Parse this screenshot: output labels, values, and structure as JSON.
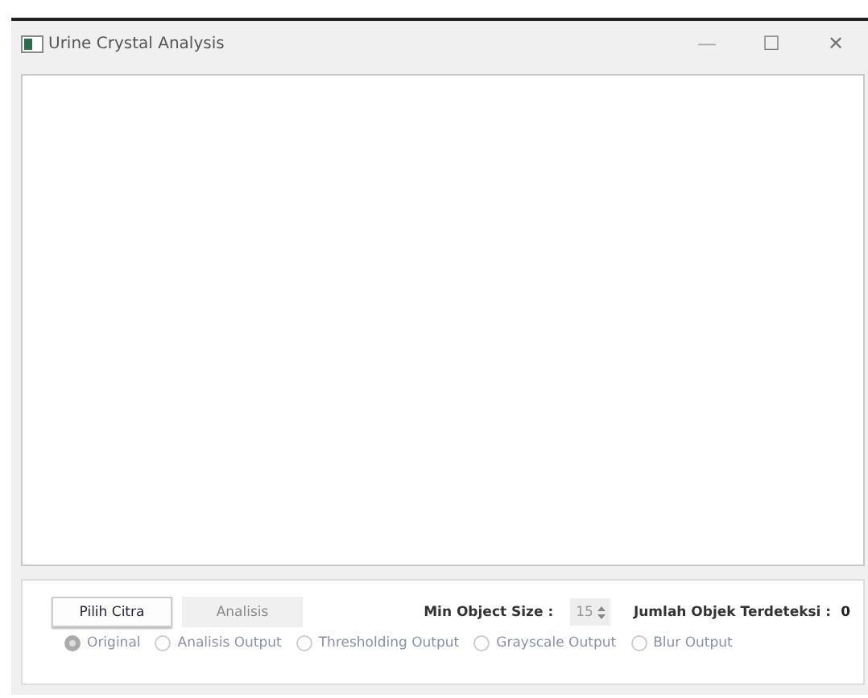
{
  "window": {
    "title": "Urine Crystal Analysis",
    "controls": [
      "—",
      "☐",
      "✕"
    ]
  },
  "toolbar": {
    "buttons": [
      {
        "label": "Pilih Citra",
        "disabled": false
      },
      {
        "label": "Analisis",
        "disabled": true
      }
    ],
    "min_object_size": {
      "label": "Min Object Size :",
      "value": "15",
      "disabled": true
    },
    "detected": {
      "label": "Jumlah Objek Terdeteksi :",
      "value": "0"
    }
  },
  "views": [
    {
      "label": "Original",
      "selected": true,
      "disabled": true
    },
    {
      "label": "Analisis Output",
      "selected": false,
      "disabled": true
    },
    {
      "label": "Thresholding Output",
      "selected": false,
      "disabled": true
    },
    {
      "label": "Grayscale Output",
      "selected": false,
      "disabled": true
    },
    {
      "label": "Blur Output",
      "selected": false,
      "disabled": true
    }
  ]
}
